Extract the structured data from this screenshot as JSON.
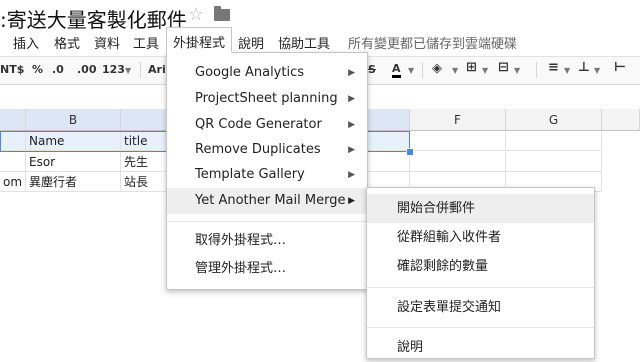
{
  "doc": {
    "title": ":寄送大量客製化郵件",
    "star_icon": "star-icon",
    "folder_icon": "folder-icon"
  },
  "menubar": {
    "items": [
      "插入",
      "格式",
      "資料",
      "工具",
      "外掛程式",
      "說明",
      "協助工具"
    ],
    "active": "外掛程式",
    "save_status": "所有變更都已儲存到雲端硬碟"
  },
  "toolbar": {
    "currency": "NT$",
    "percent": "%",
    "dec_decrease": ".0",
    "dec_increase": ".00",
    "more_formats": "123",
    "font": "Aria",
    "strike": "S",
    "text_color": "A"
  },
  "columns": [
    "B",
    "F",
    "G"
  ],
  "rows": [
    {
      "a": "",
      "b": "Name",
      "c": "title"
    },
    {
      "a": "",
      "b": "Esor",
      "c": "先生"
    },
    {
      "a": "om",
      "b": "異塵行者",
      "c": "站長"
    }
  ],
  "addons_menu": {
    "items": [
      {
        "label": "Google Analytics",
        "has_submenu": true
      },
      {
        "label": "ProjectSheet planning",
        "has_submenu": true
      },
      {
        "label": "QR Code Generator",
        "has_submenu": true
      },
      {
        "label": "Remove Duplicates",
        "has_submenu": true
      },
      {
        "label": "Template Gallery",
        "has_submenu": true
      },
      {
        "label": "Yet Another Mail Merge",
        "has_submenu": true,
        "highlighted": true
      }
    ],
    "get_addons": "取得外掛程式…",
    "manage_addons": "管理外掛程式…",
    "arrow": "▶"
  },
  "submenu": {
    "items": [
      "開始合併郵件",
      "從群組輸入收件者",
      "確認剩餘的數量"
    ],
    "form_notify": "設定表單提交通知",
    "help": "說明"
  },
  "colors": {
    "accent": "#4a86e8",
    "highlight": "#eeeeee",
    "header_bg": "#f3f3f3"
  }
}
